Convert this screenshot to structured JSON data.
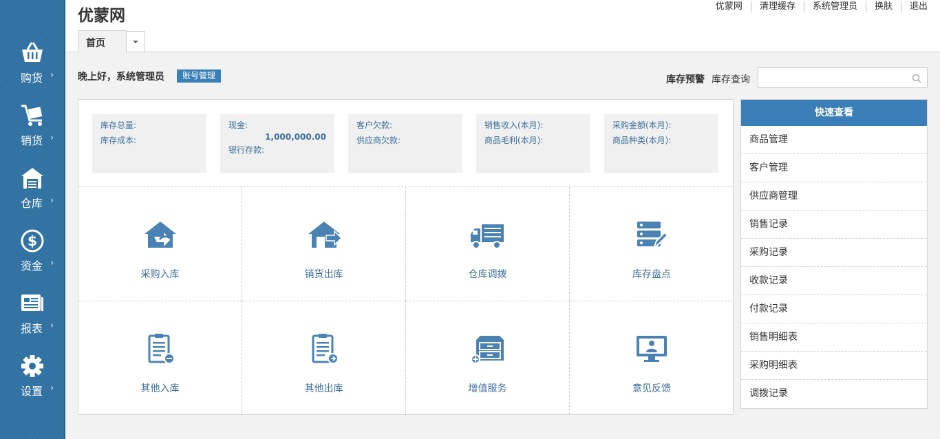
{
  "brand": "优蒙网",
  "top_links": [
    "优蒙网",
    "清理缓存",
    "系统管理员",
    "换肤",
    "退出"
  ],
  "tabs": {
    "home": "首页"
  },
  "sidebar": {
    "items": [
      {
        "label": "购货",
        "icon": "basket-icon"
      },
      {
        "label": "销货",
        "icon": "cart-icon"
      },
      {
        "label": "仓库",
        "icon": "warehouse-icon"
      },
      {
        "label": "资金",
        "icon": "dollar-icon"
      },
      {
        "label": "报表",
        "icon": "report-icon"
      },
      {
        "label": "设置",
        "icon": "gear-icon"
      }
    ],
    "arrow": "›"
  },
  "greeting": {
    "text": "晚上好，系统管理员",
    "account_button": "账号管理"
  },
  "stock": {
    "warning": "库存预警",
    "query_label": "库存查询",
    "search_value": ""
  },
  "stats": [
    {
      "lines": [
        "库存总量:",
        "库存成本:"
      ],
      "value": ""
    },
    {
      "lines": [
        "现金:",
        "银行存款:"
      ],
      "value": "1,000,000.00"
    },
    {
      "lines": [
        "客户欠款:",
        "供应商欠款:"
      ],
      "value": ""
    },
    {
      "lines": [
        "销售收入(本月):",
        "商品毛利(本月):"
      ],
      "value": ""
    },
    {
      "lines": [
        "采购金额(本月):",
        "商品种类(本月):"
      ],
      "value": ""
    }
  ],
  "shortcuts": [
    {
      "label": "采购入库",
      "icon": "house-in-icon"
    },
    {
      "label": "销货出库",
      "icon": "house-out-icon"
    },
    {
      "label": "仓库调拨",
      "icon": "truck-icon"
    },
    {
      "label": "库存盘点",
      "icon": "inventory-icon"
    },
    {
      "label": "其他入库",
      "icon": "clipboard-in-icon"
    },
    {
      "label": "其他出库",
      "icon": "clipboard-out-icon"
    },
    {
      "label": "增值服务",
      "icon": "cabinet-icon"
    },
    {
      "label": "意见反馈",
      "icon": "monitor-icon"
    }
  ],
  "quick_view": {
    "title": "快速查看",
    "items": [
      "商品管理",
      "客户管理",
      "供应商管理",
      "销售记录",
      "采购记录",
      "收款记录",
      "付款记录",
      "销售明细表",
      "采购明细表",
      "调拨记录"
    ]
  },
  "colors": {
    "sidebar": "#2f73a5",
    "accent": "#3a7fb8",
    "icon": "#4a82b4",
    "text_blue": "#3d6f9a"
  }
}
